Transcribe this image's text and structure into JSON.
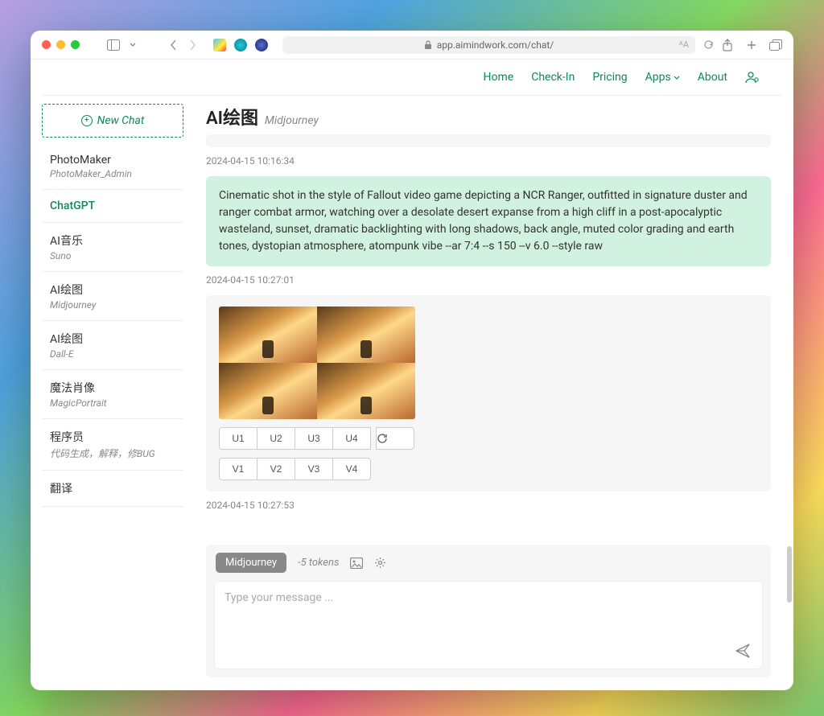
{
  "browser": {
    "url": "app.aimindwork.com/chat/"
  },
  "nav": {
    "home": "Home",
    "checkin": "Check-In",
    "pricing": "Pricing",
    "apps": "Apps",
    "about": "About"
  },
  "sidebar": {
    "new_chat": "New Chat",
    "items": [
      {
        "title": "PhotoMaker",
        "subtitle": "PhotoMaker_Admin"
      },
      {
        "title": "ChatGPT",
        "subtitle": ""
      },
      {
        "title": "AI音乐",
        "subtitle": "Suno"
      },
      {
        "title": "AI绘图",
        "subtitle": "Midjourney"
      },
      {
        "title": "AI绘图",
        "subtitle": "Dall-E"
      },
      {
        "title": "魔法肖像",
        "subtitle": "MagicPortrait"
      },
      {
        "title": "程序员",
        "subtitle": "代码生成，解释，修BUG"
      },
      {
        "title": "翻译",
        "subtitle": ""
      }
    ]
  },
  "header": {
    "title": "AI绘图",
    "subtitle": "Midjourney"
  },
  "messages": {
    "ts1": "2024-04-15 10:16:34",
    "prompt": "Cinematic shot in the style of Fallout video game depicting a NCR Ranger, outfitted in signature duster and ranger combat armor, watching over a desolate desert expanse from a high cliff in a post-apocalyptic wasteland, sunset, dramatic backlighting with long shadows, back angle, muted color grading and earth tones, dystopian atmosphere, atompunk vibe --ar 7:4 --s 150 --v 6.0 --style raw",
    "ts2": "2024-04-15 10:27:01",
    "ts3": "2024-04-15 10:27:53",
    "u": [
      "U1",
      "U2",
      "U3",
      "U4"
    ],
    "v": [
      "V1",
      "V2",
      "V3",
      "V4"
    ]
  },
  "composer": {
    "model": "Midjourney",
    "tokens": "-5 tokens",
    "placeholder": "Type your message ..."
  }
}
